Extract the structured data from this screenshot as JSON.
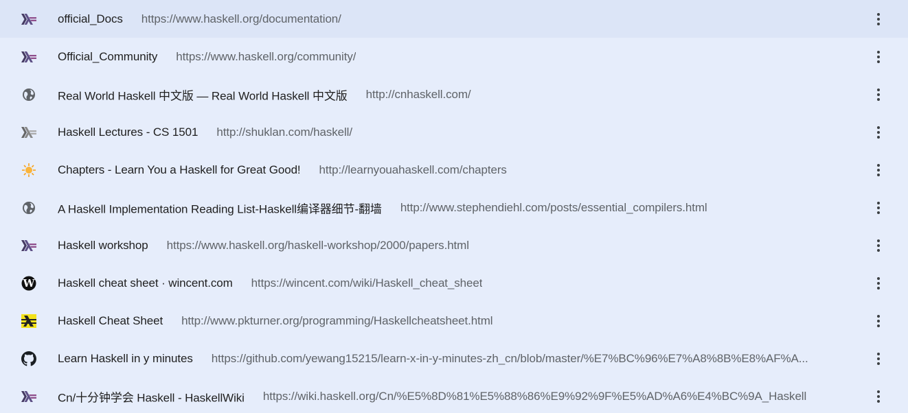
{
  "bookmarks": [
    {
      "title": "official_Docs",
      "url": "https://www.haskell.org/documentation/",
      "icon": "haskell-logo-icon"
    },
    {
      "title": "Official_Community",
      "url": "https://www.haskell.org/community/",
      "icon": "haskell-logo-icon"
    },
    {
      "title": "Real World Haskell 中文版 — Real World Haskell 中文版",
      "url": "http://cnhaskell.com/",
      "icon": "globe-icon"
    },
    {
      "title": "Haskell Lectures - CS 1501",
      "url": "http://shuklan.com/haskell/",
      "icon": "haskell-gray-logo-icon"
    },
    {
      "title": "Chapters - Learn You a Haskell for Great Good!",
      "url": "http://learnyouahaskell.com/chapters",
      "icon": "sun-icon"
    },
    {
      "title": "A Haskell Implementation Reading List-Haskell编译器细节-翻墙",
      "url": "http://www.stephendiehl.com/posts/essential_compilers.html",
      "icon": "globe-icon"
    },
    {
      "title": "Haskell workshop",
      "url": "https://www.haskell.org/haskell-workshop/2000/papers.html",
      "icon": "haskell-logo-icon"
    },
    {
      "title": "Haskell cheat sheet · wincent.com",
      "url": "https://wincent.com/wiki/Haskell_cheat_sheet",
      "icon": "wincent-w-icon"
    },
    {
      "title": "Haskell Cheat Sheet",
      "url": "http://www.pkturner.org/programming/Haskellcheatsheet.html",
      "icon": "yellow-lambda-icon"
    },
    {
      "title": "Learn Haskell in y minutes",
      "url": "https://github.com/yewang15215/learn-x-in-y-minutes-zh_cn/blob/master/%E7%BC%96%E7%A8%8B%E8%AF%A...",
      "icon": "github-icon"
    },
    {
      "title": "Cn/十分钟学会 Haskell - HaskellWiki",
      "url": "https://wiki.haskell.org/Cn/%E5%8D%81%E5%88%86%E9%92%9F%E5%AD%A6%E4%BC%9A_Haskell",
      "icon": "haskell-logo-icon"
    }
  ],
  "more_icon": "more-vert-icon",
  "colors": {
    "background": "#e6edfb",
    "title_text": "#1f1f1f",
    "url_text": "#5f6368",
    "haskell_purple": "#5e4f87"
  }
}
